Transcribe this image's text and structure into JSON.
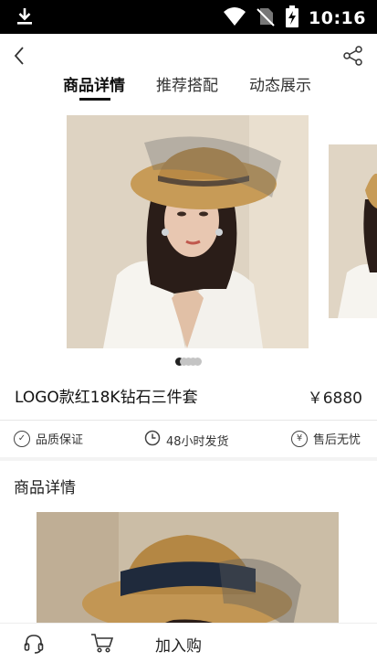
{
  "status_bar": {
    "time": "10:16"
  },
  "tabs": [
    {
      "label": "商品详情"
    },
    {
      "label": "推荐搭配"
    },
    {
      "label": "动态展示"
    }
  ],
  "gallery": {
    "slide_count": 5,
    "active_index": 0
  },
  "product": {
    "name": "LOGO款红18K钻石三件套",
    "price": "￥6880"
  },
  "guarantees": [
    {
      "label": "品质保证",
      "icon": "check-circle-icon"
    },
    {
      "label": "48小时发货",
      "icon": "clock-icon"
    },
    {
      "label": "售后无忧",
      "icon": "yen-circle-icon"
    }
  ],
  "details": {
    "section_title": "商品详情"
  },
  "bottom_bar": {
    "add_to_cart_label": "加入购"
  }
}
